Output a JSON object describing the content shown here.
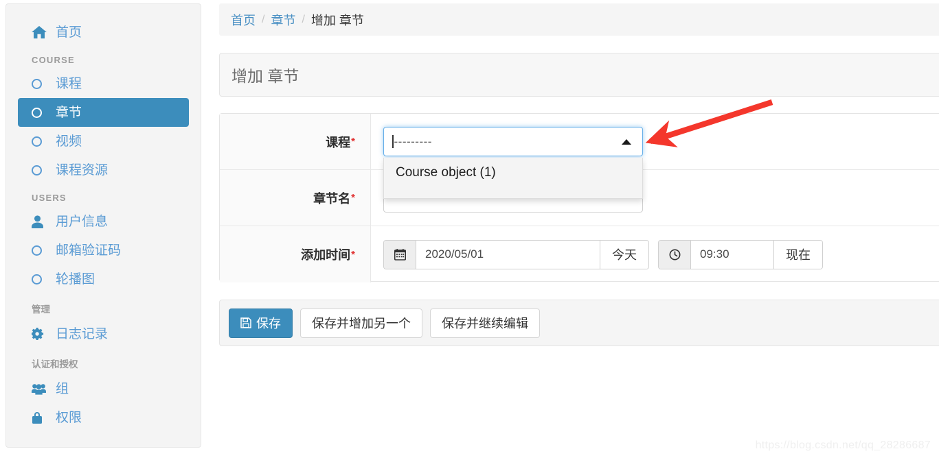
{
  "sidebar": {
    "home": {
      "label": "首页",
      "icon": "home-icon"
    },
    "groups": [
      {
        "header": "COURSE",
        "items": [
          {
            "label": "课程",
            "icon": "circle-icon",
            "active": false
          },
          {
            "label": "章节",
            "icon": "circle-icon",
            "active": true
          },
          {
            "label": "视频",
            "icon": "circle-icon",
            "active": false
          },
          {
            "label": "课程资源",
            "icon": "circle-icon",
            "active": false
          }
        ]
      },
      {
        "header": "USERS",
        "items": [
          {
            "label": "用户信息",
            "icon": "user-icon",
            "active": false
          },
          {
            "label": "邮箱验证码",
            "icon": "circle-icon",
            "active": false
          },
          {
            "label": "轮播图",
            "icon": "circle-icon",
            "active": false
          }
        ]
      },
      {
        "header": "管理",
        "items": [
          {
            "label": "日志记录",
            "icon": "gear-icon",
            "active": false
          }
        ]
      },
      {
        "header": "认证和授权",
        "items": [
          {
            "label": "组",
            "icon": "users-group-icon",
            "active": false
          },
          {
            "label": "权限",
            "icon": "lock-icon",
            "active": false
          }
        ]
      }
    ]
  },
  "breadcrumb": {
    "items": [
      "首页",
      "章节",
      "增加 章节"
    ],
    "separator": "/"
  },
  "page": {
    "title": "增加 章节"
  },
  "form": {
    "rows": [
      {
        "label": "课程",
        "required": "*",
        "type": "select"
      },
      {
        "label": "章节名",
        "required": "*",
        "type": "text"
      },
      {
        "label": "添加时间",
        "required": "*",
        "type": "datetime"
      }
    ],
    "course_select": {
      "placeholder": "---------",
      "caret": "caret-up-icon",
      "open": true,
      "options": [
        "Course object (1)"
      ],
      "highlighted_option": "Course object (1)"
    },
    "chapter_name": {
      "value": "",
      "placeholder": ""
    },
    "datetime": {
      "date_value": "2020/05/01",
      "date_icon": "calendar-icon",
      "today_label": "今天",
      "time_value": "09:30",
      "time_icon": "clock-icon",
      "now_label": "现在"
    }
  },
  "actions": {
    "save": {
      "label": "保存",
      "icon": "save-icon"
    },
    "save_and_add_another": {
      "label": "保存并增加另一个"
    },
    "save_and_continue": {
      "label": "保存并继续编辑"
    }
  },
  "annotation": {
    "arrow_color": "#f4372c"
  },
  "watermark": {
    "text": "https://blog.csdn.net/qq_28286687"
  },
  "colors": {
    "accent": "#3c8dbc",
    "link": "#5a9bd4",
    "required": "#e03131",
    "focus_border": "#66afe9"
  }
}
